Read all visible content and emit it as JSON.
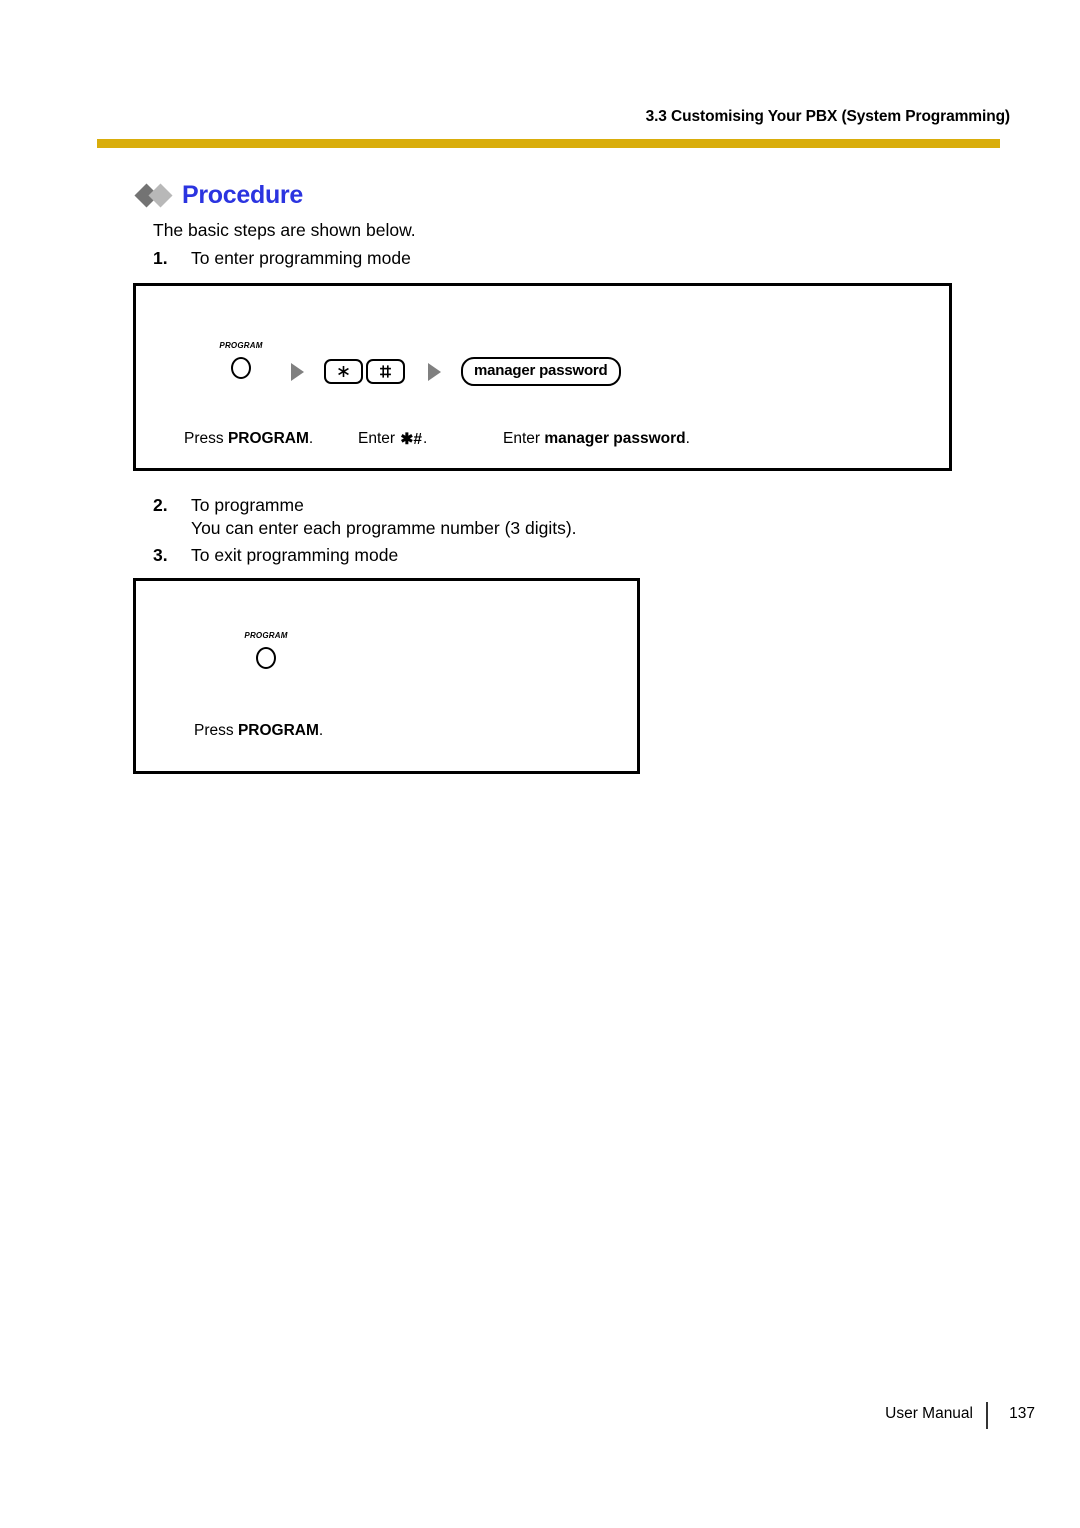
{
  "header": {
    "title": "3.3 Customising Your PBX (System Programming)",
    "rule_color": "#d9ad0b"
  },
  "section": {
    "heading": "Procedure",
    "heading_color": "#2b34e0",
    "diamond_dark": "#737373",
    "diamond_light": "#b8b8b8",
    "intro": "The basic steps are shown below."
  },
  "steps": [
    {
      "number": "1.",
      "text": "To enter programming mode"
    },
    {
      "number": "2.",
      "text": "To programme",
      "sub": "You can enter each programme number (3 digits)."
    },
    {
      "number": "3.",
      "text": "To exit programming mode"
    }
  ],
  "diagram_1": {
    "program_key_label": "PROGRAM",
    "key_star": "star-key",
    "key_hash": "hash-key",
    "bubble_label": "manager password",
    "captions": [
      {
        "prefix": "Press ",
        "bold": "PROGRAM",
        "suffix": "."
      },
      {
        "prefix": "Enter ",
        "bold": "",
        "suffix": "."
      },
      {
        "prefix": "Enter ",
        "bold": "manager password",
        "suffix": "."
      }
    ],
    "caption_2_symbols": "✱#"
  },
  "diagram_2": {
    "program_key_label": "PROGRAM",
    "caption": {
      "prefix": "Press ",
      "bold": "PROGRAM",
      "suffix": "."
    }
  },
  "footer": {
    "label": "User Manual",
    "page": "137"
  }
}
